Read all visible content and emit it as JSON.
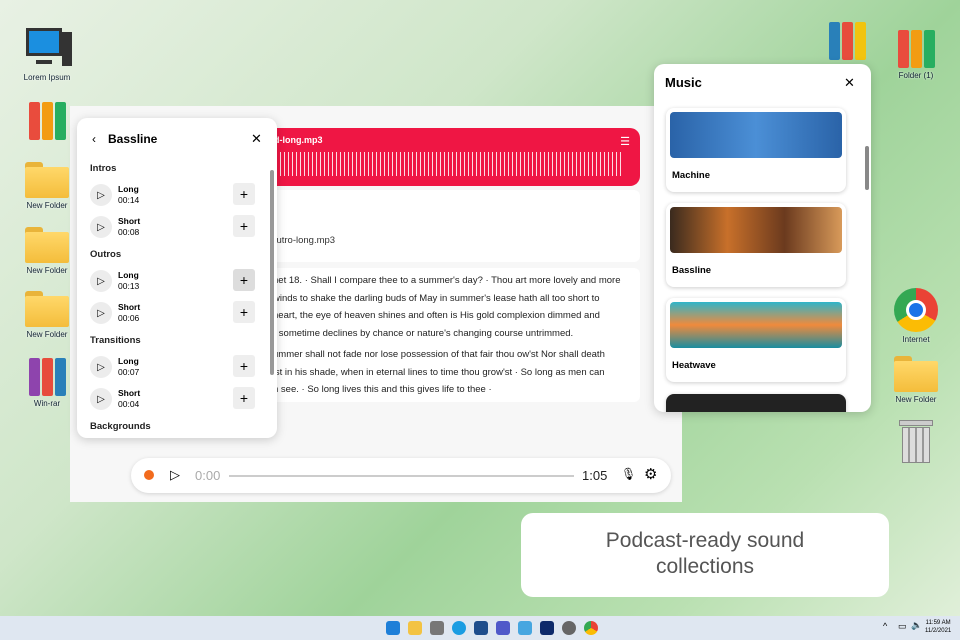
{
  "desktop": {
    "left": [
      "Lorem Ipsum",
      "New Folder",
      "New Folder",
      "New Folder",
      "Win-rar"
    ],
    "right": [
      "Folder (1)",
      "Internet",
      "New Folder"
    ]
  },
  "bassline": {
    "title": "Bassline",
    "sections": [
      {
        "name": "Intros",
        "items": [
          {
            "label": "Long",
            "time": "00:14"
          },
          {
            "label": "Short",
            "time": "00:08"
          }
        ]
      },
      {
        "name": "Outros",
        "items": [
          {
            "label": "Long",
            "time": "00:13"
          },
          {
            "label": "Short",
            "time": "00:06"
          }
        ]
      },
      {
        "name": "Transitions",
        "items": [
          {
            "label": "Long",
            "time": "00:07"
          },
          {
            "label": "Short",
            "time": "00:04"
          }
        ]
      },
      {
        "name": "Backgrounds",
        "items": []
      }
    ]
  },
  "editor": {
    "track_name": "d-long.mp3",
    "outro_file": "-outro-long.mp3",
    "lines": [
      "net 18. · Shall I compare thee to a summer's day? · Thou art more lovely and more",
      "winds to shake the darling buds of May in summer's lease hath all too short to",
      "heart, the eye of heaven shines and often is His gold complexion dimmed and",
      "r sometime declines by chance or nature's changing course untrimmed.",
      "ummer shall not fade nor lose possession of that fair thou ow'st Nor shall death",
      "'st in his shade, when in eternal lines to time thou grow'st · So long as men can",
      "n see. · So long lives this and this gives life to thee ·"
    ]
  },
  "player": {
    "current": "0:00",
    "total": "1:05",
    "progress": 0
  },
  "music": {
    "title": "Music",
    "items": [
      "Machine",
      "Bassline",
      "Heatwave"
    ]
  },
  "caption": {
    "line1": "Podcast-ready sound",
    "line2": "collections"
  },
  "taskbar": {
    "time": "11:59 AM",
    "date": "11/2/2021"
  }
}
